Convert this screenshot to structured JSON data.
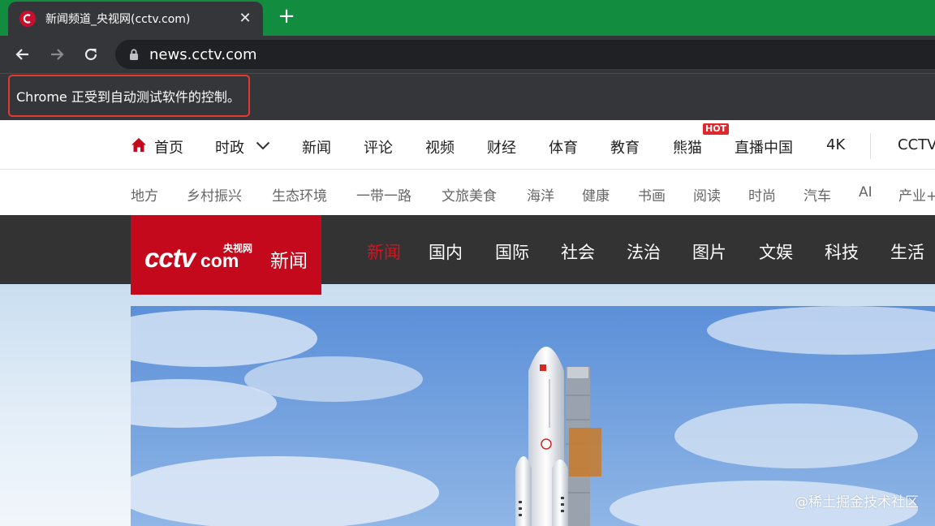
{
  "browser": {
    "tab_title": "新闻频道_央视网(cctv.com)",
    "tab_close": "✕",
    "new_tab": "+",
    "url": "news.cctv.com",
    "infobar_text": "Chrome 正受到自动测试软件的控制。",
    "tab_strip_color": "#128c3f",
    "chrome_dark": "#35363a"
  },
  "nav_primary": {
    "items": [
      "首页",
      "时政",
      "新闻",
      "评论",
      "视频",
      "财经",
      "体育",
      "教育",
      "熊猫",
      "直播中国",
      "4K",
      "CCTV"
    ],
    "hot_badge": "HOT",
    "home_icon": "house-icon",
    "dropdown_icon": "chevron-down-icon"
  },
  "nav_secondary": {
    "items": [
      "地方",
      "乡村振兴",
      "生态环境",
      "一带一路",
      "文旅美食",
      "海洋",
      "健康",
      "书画",
      "阅读",
      "时尚",
      "汽车",
      "AI",
      "产业+"
    ]
  },
  "channel_bar": {
    "logo_sub": "央视网",
    "logo_main": "CCTV.com",
    "logo_channel": "新闻",
    "items": [
      "新闻",
      "国内",
      "国际",
      "社会",
      "法治",
      "图片",
      "文娱",
      "科技",
      "生活"
    ],
    "active_index": 0,
    "brand_red": "#c3091b"
  },
  "hero": {
    "watermark": "@稀土掘金技术社区"
  }
}
